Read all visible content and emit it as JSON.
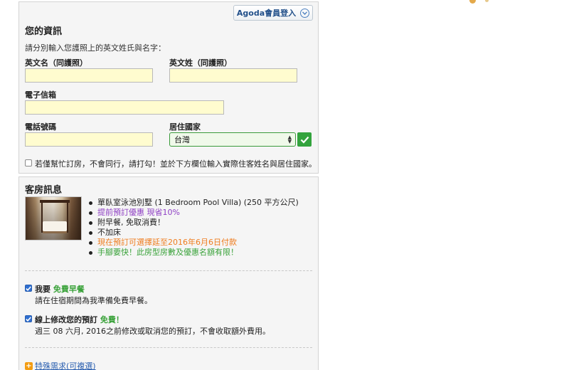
{
  "info": {
    "title": "您的資訊",
    "agoda_login": "Agoda會員登入",
    "hint": "請分別輸入您護照上的英文姓氏與名字：",
    "first_name_label": "英文名（同護照）",
    "last_name_label": "英文姓（同護照）",
    "email_label": "電子信箱",
    "phone_label": "電話號碼",
    "country_label": "居住國家",
    "country_value": "台灣",
    "booking_for_other": "若僅幫忙訂房，不會同行，請打勾！並於下方欄位輸入實際住客姓名與居住國家。",
    "first_name_value": "",
    "last_name_value": "",
    "email_value": "",
    "phone_value": ""
  },
  "room": {
    "title": "客房訊息",
    "bullets": [
      {
        "text": "單臥室泳池別墅 (1 Bedroom Pool Villa) (250 平方公尺)",
        "color": "#222222"
      },
      {
        "text": "提前預訂優惠 現省10%",
        "color": "#8e3fc4"
      },
      {
        "text": "附早餐, 免取消費！",
        "color": "#222222"
      },
      {
        "text": "不加床",
        "color": "#222222"
      },
      {
        "text": "現在預訂可選擇延至2016年6月6日付款",
        "color": "#ef7d1f"
      },
      {
        "text": "手腳要快！此房型房數及優惠名額有限！",
        "color": "#3aa23a"
      }
    ],
    "breakfast_prefix": "我要",
    "breakfast_highlight": "免費早餐",
    "breakfast_desc": "請在住宿期間為我準備免費早餐。",
    "modify_prefix": "線上修改您的預訂",
    "modify_highlight": "免費！",
    "modify_desc": "週三 08 六月, 2016之前修改或取消您的預訂，不會收取額外費用。",
    "special_request": "特殊需求(可複選)"
  },
  "colors": {
    "accent_green": "#33a33d",
    "field_yellow": "#fffccf",
    "link_blue": "#2a5fb0"
  }
}
